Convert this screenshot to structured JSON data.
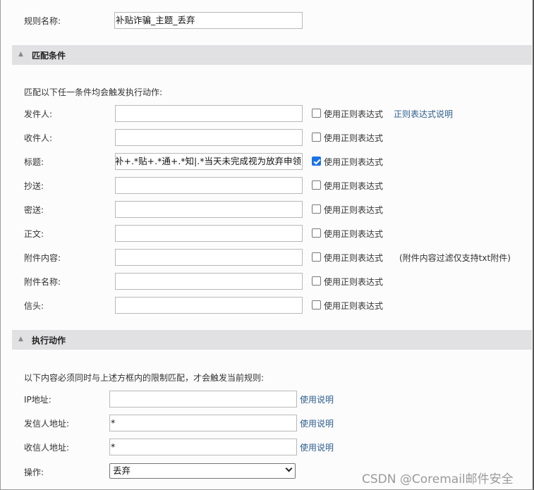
{
  "rule_name": {
    "label": "规则名称:",
    "value": "补贴诈骗_主题_丢弃"
  },
  "match_section": {
    "title": "匹配条件",
    "description": "匹配以下任一条件均会触发执行动作:",
    "regex_help_link": "正则表达式说明",
    "attachment_note": "(附件内容过滤仅支持txt附件)",
    "conditions": [
      {
        "label": "发件人:",
        "value": "",
        "regex_label": "使用正则表达式",
        "regex_checked": false
      },
      {
        "label": "收件人:",
        "value": "",
        "regex_label": "使用正则表达式",
        "regex_checked": false
      },
      {
        "label": "标题:",
        "value": "补+.*贴+.*通+.*知|.*当天未完成视为放弃申领",
        "regex_label": "使用正则表达式",
        "regex_checked": true
      },
      {
        "label": "抄送:",
        "value": "",
        "regex_label": "使用正则表达式",
        "regex_checked": false
      },
      {
        "label": "密送:",
        "value": "",
        "regex_label": "使用正则表达式",
        "regex_checked": false
      },
      {
        "label": "正文:",
        "value": "",
        "regex_label": "使用正则表达式",
        "regex_checked": false
      },
      {
        "label": "附件内容:",
        "value": "",
        "regex_label": "使用正则表达式",
        "regex_checked": false
      },
      {
        "label": "附件名称:",
        "value": "",
        "regex_label": "使用正则表达式",
        "regex_checked": false
      },
      {
        "label": "信头:",
        "value": "",
        "regex_label": "使用正则表达式",
        "regex_checked": false
      }
    ]
  },
  "action_section": {
    "title": "执行动作",
    "description": "以下内容必须同时与上述方框内的限制匹配，才会触发当前规则:",
    "fields": [
      {
        "label": "IP地址:",
        "value": "",
        "help_link": "使用说明"
      },
      {
        "label": "发信人地址:",
        "value": "*",
        "help_link": "使用说明"
      },
      {
        "label": "收信人地址:",
        "value": "*",
        "help_link": "使用说明"
      }
    ],
    "operation": {
      "label": "操作:",
      "value": "丢弃"
    }
  },
  "watermark": "CSDN @Coremail邮件安全",
  "icons": {
    "collapse": "collapse-up-icon",
    "dropdown": "chevron-down-icon",
    "checkbox": "checkbox-icon"
  },
  "colors": {
    "section_bg": "#e1e1e3",
    "link": "#2d5e8e",
    "checkbox_checked": "#1a73e8"
  }
}
